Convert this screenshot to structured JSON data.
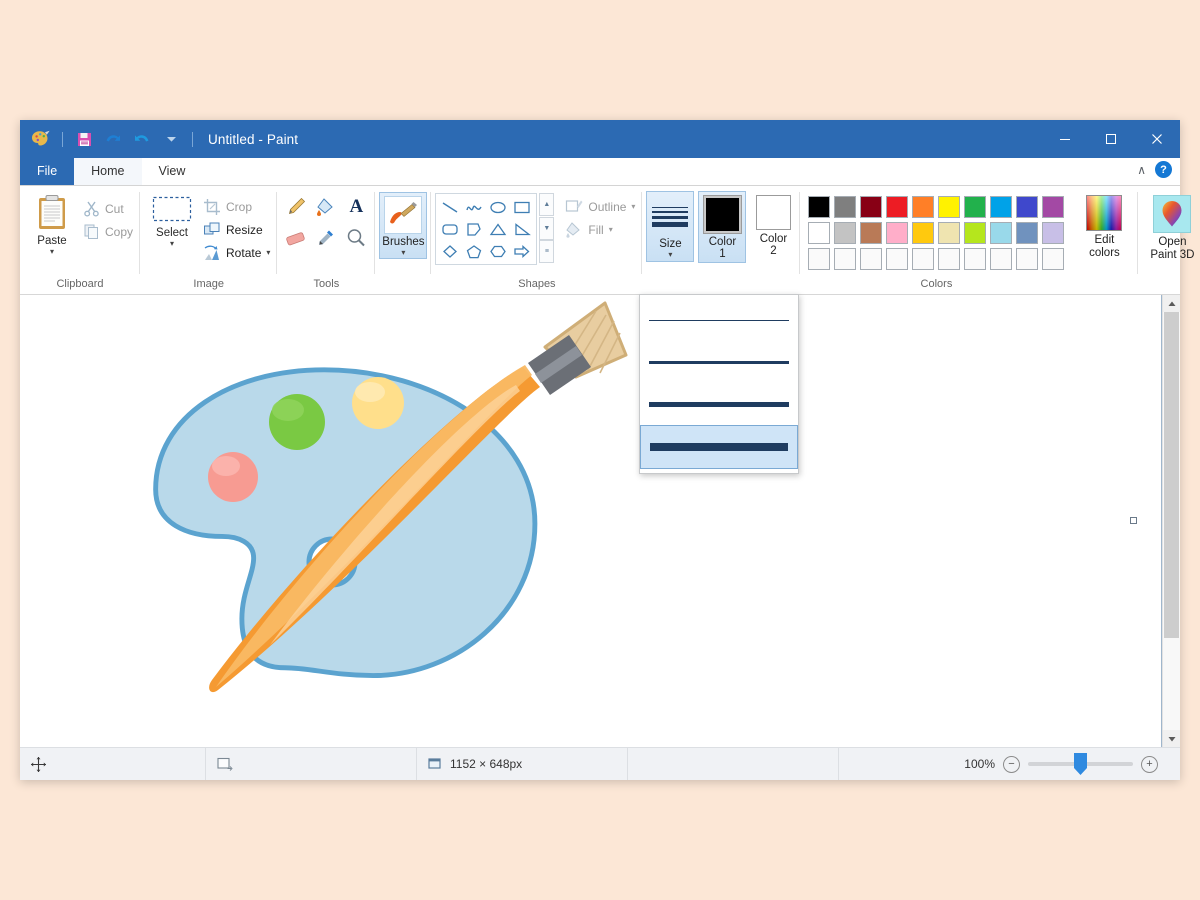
{
  "window": {
    "title": "Untitled - Paint",
    "quick_access": [
      "paint-palette-icon",
      "save-icon",
      "undo-icon",
      "redo-icon",
      "customize-qat-icon"
    ],
    "controls": {
      "minimize": "–",
      "maximize": "□",
      "close": "✕"
    }
  },
  "tabs": [
    {
      "label": "File",
      "kind": "file"
    },
    {
      "label": "Home",
      "kind": "active"
    },
    {
      "label": "View",
      "kind": "normal"
    }
  ],
  "ribbon_right": {
    "collapse": "∧",
    "help": "?"
  },
  "groups": {
    "clipboard": {
      "label": "Clipboard",
      "paste": "Paste",
      "cut": "Cut",
      "copy": "Copy"
    },
    "image": {
      "label": "Image",
      "select": "Select",
      "crop": "Crop",
      "resize": "Resize",
      "rotate": "Rotate"
    },
    "tools": {
      "label": "Tools",
      "items": [
        "pencil-icon",
        "fill-with-color-icon",
        "text-icon",
        "eraser-icon",
        "color-picker-icon",
        "magnifier-icon"
      ],
      "text_glyph": "A"
    },
    "brushes": {
      "label": "Brushes",
      "brushes": "Brushes"
    },
    "shapes": {
      "label": "Shapes",
      "items": [
        "line",
        "curve",
        "oval",
        "rectangle",
        "rounded-rectangle",
        "polygon",
        "triangle",
        "right-triangle",
        "diamond",
        "pentagon",
        "hexagon",
        "right-arrow"
      ],
      "outline": "Outline",
      "fill": "Fill",
      "scroll_up": "▲",
      "scroll_down": "▼",
      "more": "≡"
    },
    "size": {
      "label": "Size",
      "caret": "▾",
      "menu_open": true,
      "options": [
        {
          "name": "1px",
          "thickness": 1,
          "selected": false
        },
        {
          "name": "3px",
          "thickness": 3,
          "selected": false
        },
        {
          "name": "5px",
          "thickness": 5,
          "selected": false
        },
        {
          "name": "8px",
          "thickness": 8,
          "selected": true
        }
      ]
    },
    "colors": {
      "label": "Colors",
      "color1_label": "Color",
      "color1_num": "1",
      "color1_value": "#000000",
      "color2_label": "Color",
      "color2_num": "2",
      "color2_value": "#ffffff",
      "edit_colors": "Edit\ncolors",
      "edit_colors_line1": "Edit",
      "edit_colors_line2": "colors",
      "row1": [
        "#000000",
        "#7f7f7f",
        "#880015",
        "#ed1c24",
        "#ff7f27",
        "#fff200",
        "#22b14c",
        "#00a2e8",
        "#3f48cc",
        "#a349a4"
      ],
      "row2": [
        "#ffffff",
        "#c3c3c3",
        "#b97a57",
        "#ffaec9",
        "#ffc90e",
        "#efe4b0",
        "#b5e61d",
        "#99d9ea",
        "#7092be",
        "#c8bfe7"
      ],
      "row3": [
        "",
        "",
        "",
        "",
        "",
        "",
        "",
        "",
        "",
        ""
      ]
    },
    "paint3d": {
      "line1": "Open",
      "line2": "Paint 3D"
    }
  },
  "canvas": {
    "artwork": "paint-palette-and-brush-illustration",
    "palette_fill": "#b9d9ea",
    "palette_stroke": "#5ba3cf",
    "blob_green": "#6cc24a",
    "blob_yellow": "#ffd97d",
    "blob_pink": "#f59b91",
    "brush_handle": "#f59a32",
    "brush_ferrule": "#6b6f76",
    "brush_bristles": "#e8cda0"
  },
  "statusbar": {
    "cursor_icon": "move-cursor-icon",
    "selection_icon": "selection-size-icon",
    "image_size_icon": "image-size-icon",
    "image_size": "1152 × 648px",
    "zoom_level": "100%",
    "zoom_out": "−",
    "zoom_in": "+"
  }
}
